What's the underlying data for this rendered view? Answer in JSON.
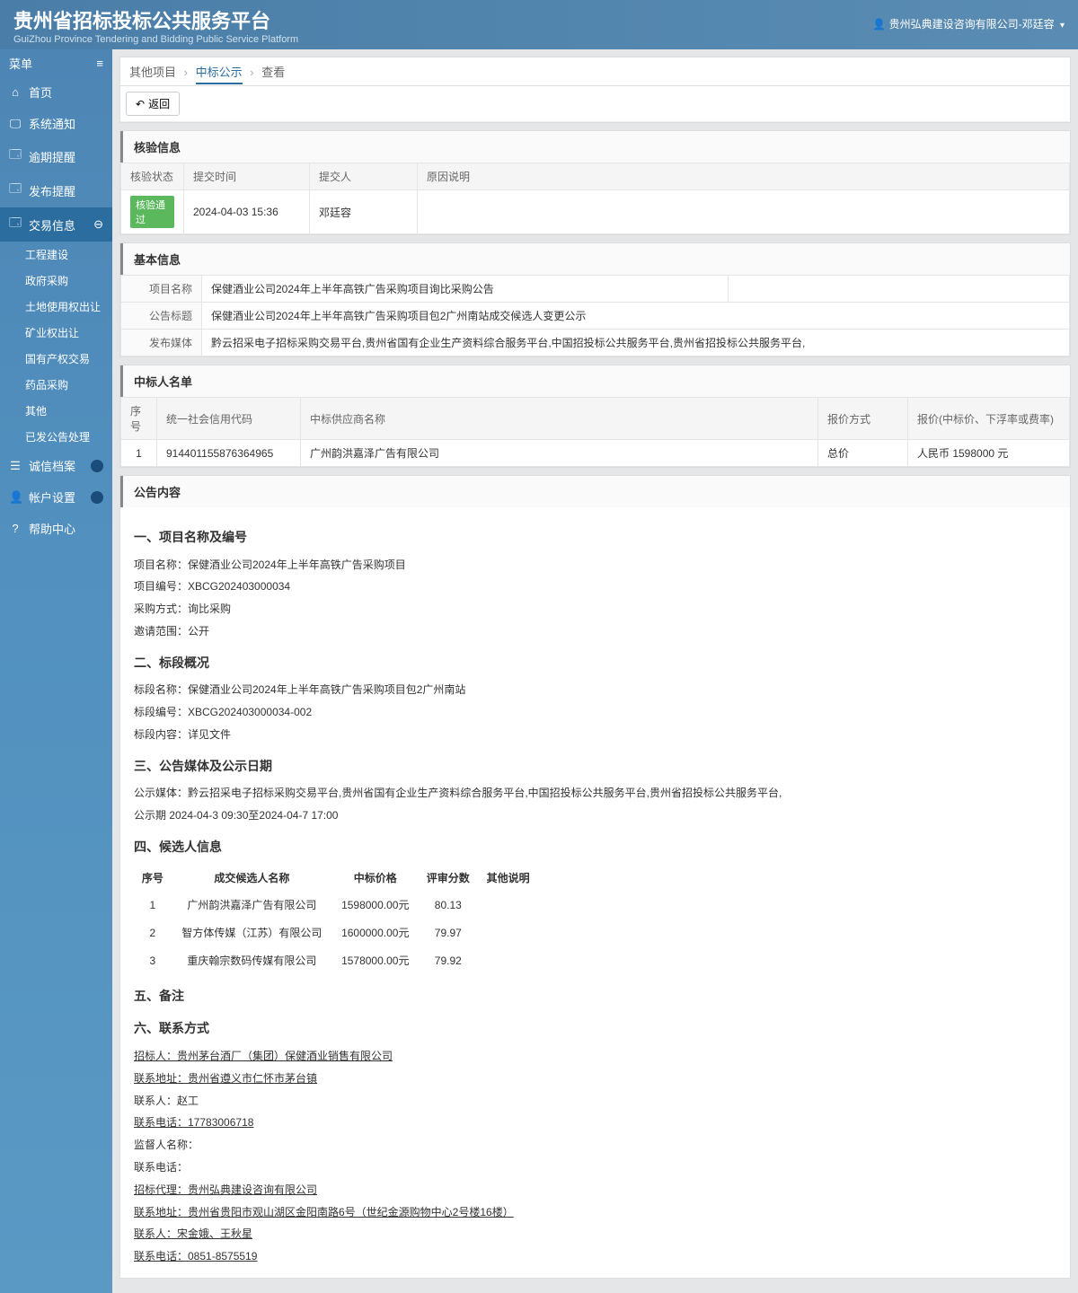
{
  "header": {
    "title": "贵州省招标投标公共服务平台",
    "subtitle": "GuiZhou Province Tendering and Bidding Public Service Platform",
    "user": "贵州弘典建设咨询有限公司-邓廷容"
  },
  "sidebar": {
    "menu_label": "菜单",
    "items": [
      {
        "icon": "⌂",
        "label": "首页"
      },
      {
        "icon": "🖵",
        "label": "系统通知"
      },
      {
        "icon": "🗔",
        "label": "逾期提醒"
      },
      {
        "icon": "🗔",
        "label": "发布提醒"
      },
      {
        "icon": "🗔",
        "label": "交易信息",
        "active": true,
        "expand": true
      },
      {
        "icon": "☰",
        "label": "诚信档案",
        "dot": true
      },
      {
        "icon": "👤",
        "label": "帐户设置",
        "dot": true
      },
      {
        "icon": "?",
        "label": "帮助中心"
      }
    ],
    "subitems": [
      "工程建设",
      "政府采购",
      "土地使用权出让",
      "矿业权出让",
      "国有产权交易",
      "药品采购",
      "其他",
      "已发公告处理"
    ]
  },
  "breadcrumb": {
    "a": "其他项目",
    "b": "中标公示",
    "c": "查看"
  },
  "back_btn": "返回",
  "verify": {
    "title": "核验信息",
    "headers": [
      "核验状态",
      "提交时间",
      "提交人",
      "原因说明"
    ],
    "status": "核验通过",
    "time": "2024-04-03 15:36",
    "person": "邓廷容",
    "reason": ""
  },
  "basic": {
    "title": "基本信息",
    "rows": [
      {
        "k": "项目名称",
        "v": "保健酒业公司2024年上半年高铁广告采购项目询比采购公告"
      },
      {
        "k": "公告标题",
        "v": "保健酒业公司2024年上半年高铁广告采购项目包2广州南站成交候选人变更公示"
      },
      {
        "k": "发布媒体",
        "v": "黔云招采电子招标采购交易平台,贵州省国有企业生产资料综合服务平台,中国招投标公共服务平台,贵州省招投标公共服务平台,"
      }
    ]
  },
  "winners": {
    "title": "中标人名单",
    "headers": [
      "序号",
      "统一社会信用代码",
      "中标供应商名称",
      "报价方式",
      "报价(中标价、下浮率或费率)"
    ],
    "rows": [
      {
        "no": "1",
        "code": "914401155876364965",
        "name": "广州韵洪嘉泽广告有限公司",
        "method": "总价",
        "price": "人民币 1598000 元"
      }
    ]
  },
  "notice": {
    "title": "公告内容",
    "s1_title": "一、项目名称及编号",
    "s1_lines": [
      "项目名称：保健酒业公司2024年上半年高铁广告采购项目",
      "项目编号：XBCG202403000034",
      "采购方式：询比采购",
      "邀请范围：公开"
    ],
    "s2_title": "二、标段概况",
    "s2_lines": [
      "标段名称：保健酒业公司2024年上半年高铁广告采购项目包2广州南站",
      "标段编号：XBCG202403000034-002",
      "标段内容：详见文件"
    ],
    "s3_title": "三、公告媒体及公示日期",
    "s3_lines": [
      "公示媒体：黔云招采电子招标采购交易平台,贵州省国有企业生产资料综合服务平台,中国招投标公共服务平台,贵州省招投标公共服务平台,",
      "公示期  2024-04-3  09:30至2024-04-7 17:00"
    ],
    "s4_title": "四、候选人信息",
    "cand_headers": [
      "序号",
      "成交候选人名称",
      "中标价格",
      "评审分数",
      "其他说明"
    ],
    "candidates": [
      {
        "no": "1",
        "name": "广州韵洪嘉泽广告有限公司",
        "price": "1598000.00元",
        "score": "80.13",
        "other": ""
      },
      {
        "no": "2",
        "name": "智方体传媒（江苏）有限公司",
        "price": "1600000.00元",
        "score": "79.97",
        "other": ""
      },
      {
        "no": "3",
        "name": "重庆翰宗数码传媒有限公司",
        "price": "1578000.00元",
        "score": "79.92",
        "other": ""
      }
    ],
    "s5_title": "五、备注",
    "s6_title": "六、联系方式",
    "contact": [
      "招标人：贵州茅台酒厂（集团）保健酒业销售有限公司",
      "联系地址：贵州省遵义市仁怀市茅台镇",
      "联系人：赵工",
      "联系电话：17783006718",
      "监督人名称：",
      "联系电话：",
      "招标代理：贵州弘典建设咨询有限公司",
      "联系地址：贵州省贵阳市观山湖区金阳南路6号（世纪金源购物中心2号楼16楼）",
      "联系人：宋金娥、王秋星",
      "联系电话：0851-8575519"
    ],
    "contact_underline": [
      true,
      true,
      false,
      true,
      false,
      false,
      true,
      true,
      true,
      true
    ]
  }
}
